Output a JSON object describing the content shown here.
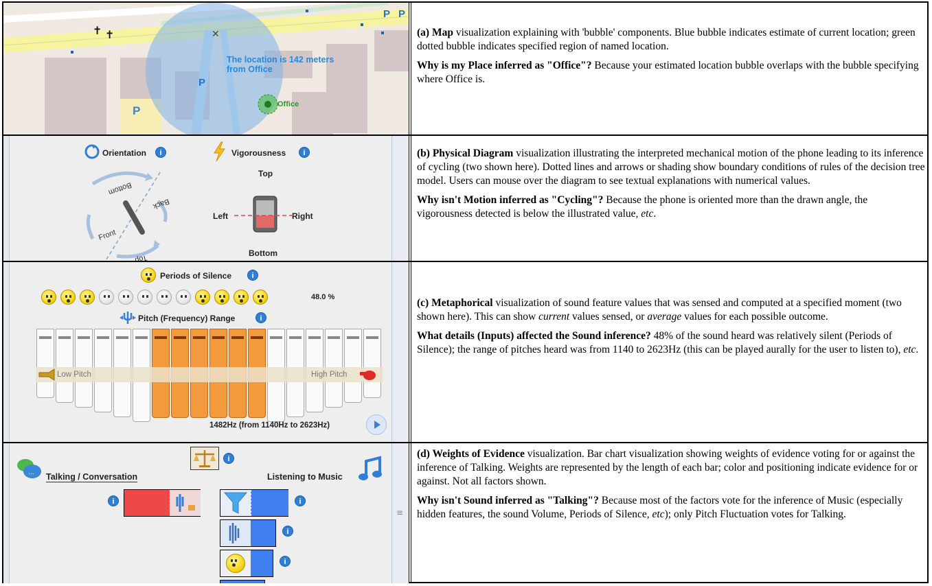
{
  "panels": {
    "a": {
      "map": {
        "location_text": "The location is 142 meters from Office",
        "office_label": "Office",
        "parking_label": "P",
        "cross_label": "✝"
      },
      "caption": {
        "title": "(a) Map",
        "text": " visualization explaining with 'bubble' components. Blue bubble indicates estimate of current location; green dotted bubble indicates specified region of named location.",
        "question": "Why is my Place inferred as \"Office\"?",
        "answer": " Because your estimated location bubble overlaps with the bubble specifying where Office is."
      }
    },
    "b": {
      "diagram": {
        "orientation_label": "Orientation",
        "vigorousness_label": "Vigorousness",
        "bottom_arc": "Bottom",
        "back_arc": "Back",
        "front_arc": "Front",
        "top_arc": "Top",
        "top_label": "Top",
        "left_label": "Left",
        "right_label": "Right",
        "bottom_label": "Bottom"
      },
      "caption": {
        "title": "(b) Physical Diagram",
        "text": " visualization illustrating the interpreted mechanical motion of the phone leading to its inference of cycling (two shown here). Dotted lines and arrows or shading show boundary conditions of rules of the decision tree model. Users can mouse over the diagram to see textual explanations with numerical values.",
        "question": "Why isn't Motion inferred as \"Cycling\"?",
        "answer_pre": " Because the phone is oriented more than the drawn angle, the vigorousness detected is below the illustrated value, ",
        "answer_etc": "etc",
        "answer_post": "."
      }
    },
    "c": {
      "viz": {
        "silence_label": "Periods of Silence",
        "silence_value": "48.0 %",
        "smileys": [
          "y",
          "y",
          "y",
          "w",
          "w",
          "w",
          "w",
          "w",
          "y",
          "y",
          "y",
          "y"
        ],
        "pitch_label": "Pitch (Frequency) Range",
        "low_pitch": "Low Pitch",
        "high_pitch": "High Pitch",
        "pitch_readout": "1482Hz (from 1140Hz to 2623Hz)",
        "pipe_count": 18,
        "active_pipes": [
          6,
          11
        ],
        "active_color": "#f39a3c"
      },
      "caption": {
        "title": "(c) Metaphorical",
        "text_1": " visualization of sound feature values that was sensed and computed at a specified moment (two shown here). This can show ",
        "text_current": "current",
        "text_2": " values sensed, or ",
        "text_average": "average",
        "text_3": " values for each possible outcome.",
        "question": "What details (Inputs) affected the Sound inference?",
        "answer_pre": " 48% of the sound heard was relatively silent (Periods of Silence); the range of pitches heard was from 1140 to 2623Hz (this can be played aurally for the user to listen to), ",
        "answer_etc": "etc",
        "answer_post": "."
      }
    },
    "d": {
      "viz": {
        "left_label": "Talking / Conversation",
        "right_label": "Listening to Music",
        "talking_color": "#f04848",
        "music_color": "#3f7ff0"
      },
      "caption": {
        "title": "(d) Weights of Evidence",
        "text": " visualization. Bar chart visualization showing weights of evidence voting for or against the inference of Talking. Weights are represented by the length of each bar; color and positioning indicate evidence for or against. Not all factors shown.",
        "question": "Why isn't Sound inferred as \"Talking\"?",
        "answer_pre": " Because most of the factors vote for the inference of Music (especially hidden features, the sound Volume, Periods of Silence, ",
        "answer_etc": "etc",
        "answer_post": "); only Pitch Fluctuation votes for Talking."
      }
    }
  }
}
